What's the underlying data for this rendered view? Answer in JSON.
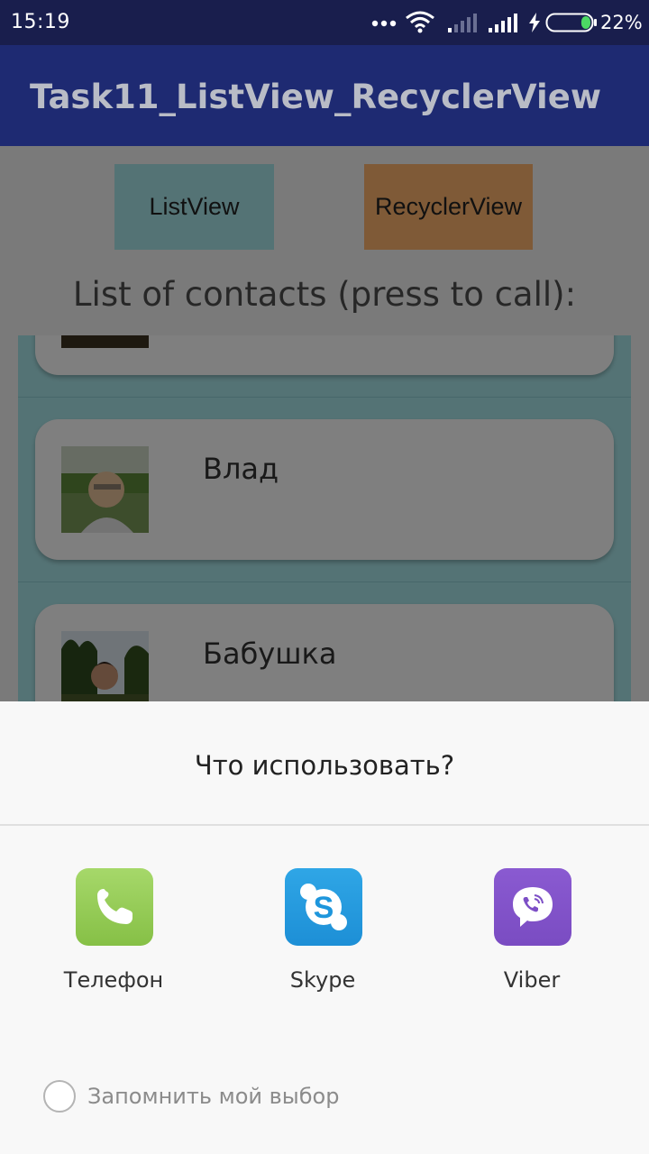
{
  "status_bar": {
    "time": "15:19",
    "battery_percent": "22%",
    "battery_level": 0.22,
    "icons": [
      "more-dots-icon",
      "wifi-icon",
      "signal-weak-icon",
      "signal-icon",
      "charging-bolt-icon",
      "battery-icon"
    ]
  },
  "app_bar": {
    "title": "Task11_ListView_RecyclerView"
  },
  "buttons": {
    "listview_label": "ListView",
    "recycler_label": "RecyclerView",
    "listview_color": "#a8e6ea",
    "recycler_color": "#ffb46e"
  },
  "list": {
    "heading": "List of contacts (press to call):",
    "background_color": "#a9e6ea",
    "contacts": [
      {
        "name": "",
        "photo": "person-photo"
      },
      {
        "name": "Влад",
        "photo": "person-photo"
      },
      {
        "name": "Бабушка",
        "photo": "person-photo"
      }
    ]
  },
  "chooser": {
    "title": "Что использовать?",
    "apps": [
      {
        "label": "Телефон",
        "icon": "phone-app-icon",
        "color": "#8bc34a"
      },
      {
        "label": "Skype",
        "icon": "skype-app-icon",
        "color": "#1e96dc"
      },
      {
        "label": "Viber",
        "icon": "viber-app-icon",
        "color": "#7d4fc6"
      }
    ],
    "remember_label": "Запомнить мой выбор",
    "remember_checked": false
  }
}
